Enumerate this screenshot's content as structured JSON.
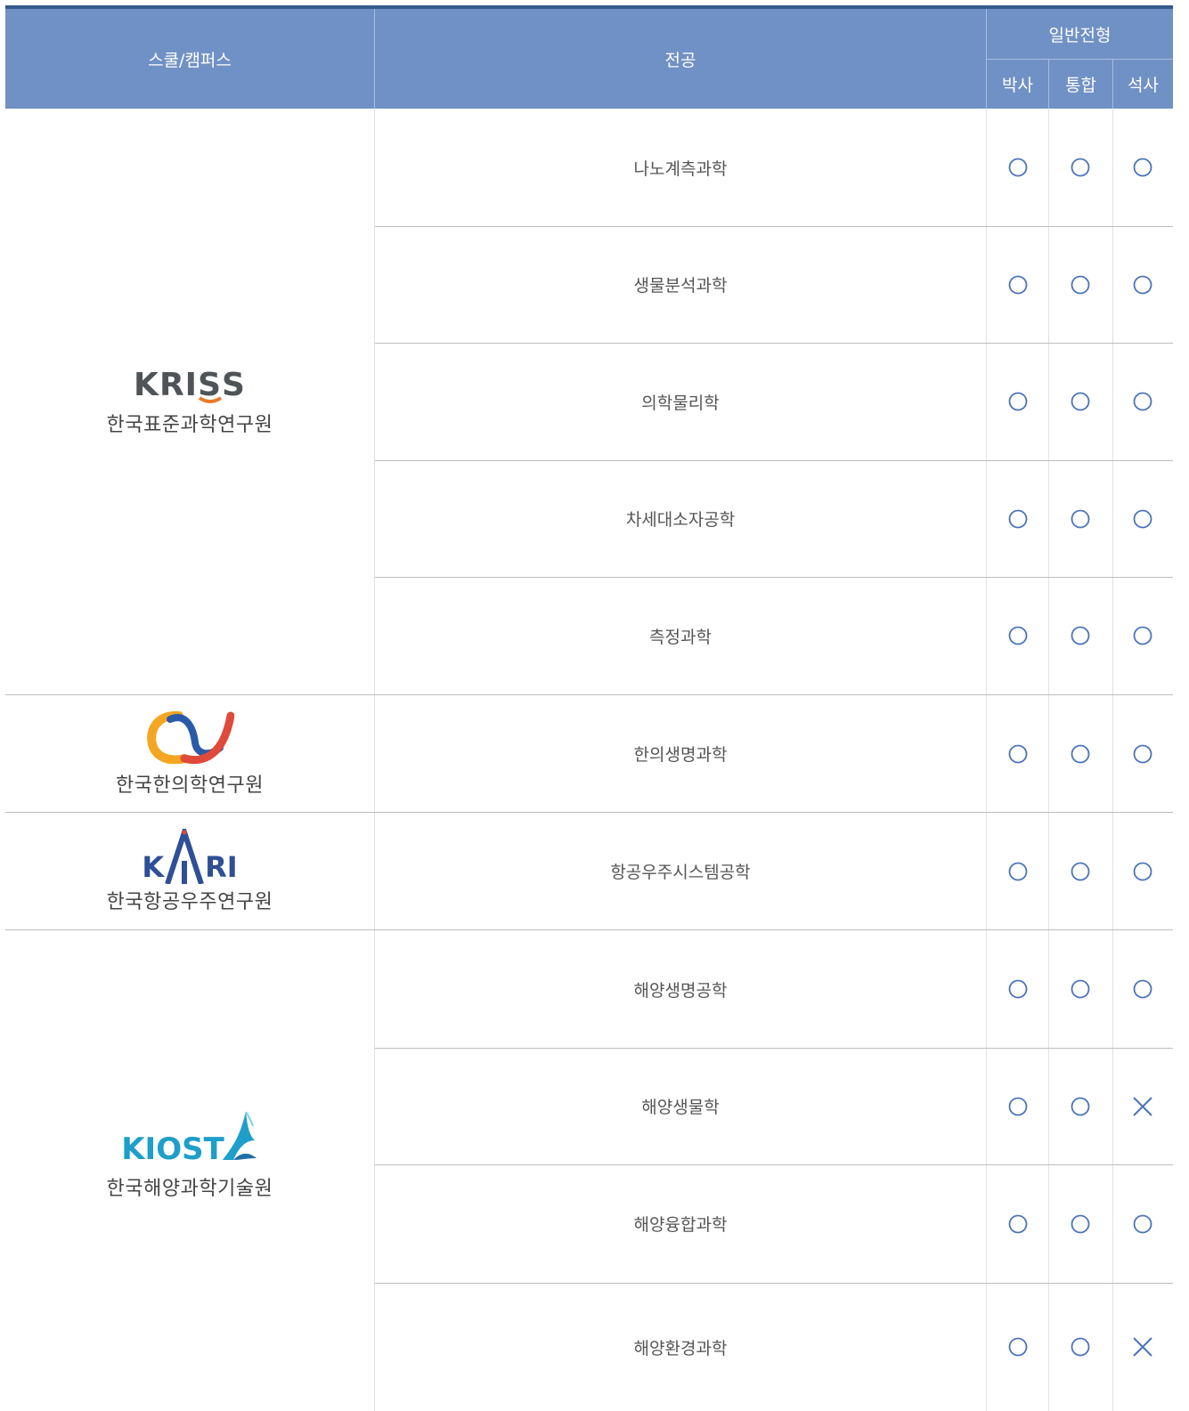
{
  "header": {
    "campus_label": "스쿨/캠퍼스",
    "major_label": "전공",
    "admission_group": "일반전형",
    "columns": [
      "박사",
      "통합",
      "석사"
    ]
  },
  "campuses": [
    {
      "key": "kriss",
      "logo_text": "KRISS",
      "name": "한국표준과학연구원"
    },
    {
      "key": "kiom",
      "logo_text": "",
      "name": "한국한의학연구원"
    },
    {
      "key": "kari",
      "logo_text": "KARI",
      "name": "한국항공우주연구원"
    },
    {
      "key": "kiost",
      "logo_text": "KIOST",
      "name": "한국해양과학기술원"
    }
  ],
  "rows": [
    {
      "major": "나노계측과학",
      "marks": [
        "O",
        "O",
        "O"
      ]
    },
    {
      "major": "생물분석과학",
      "marks": [
        "O",
        "O",
        "O"
      ]
    },
    {
      "major": "의학물리학",
      "marks": [
        "O",
        "O",
        "O"
      ]
    },
    {
      "major": "차세대소자공학",
      "marks": [
        "O",
        "O",
        "O"
      ]
    },
    {
      "major": "측정과학",
      "marks": [
        "O",
        "O",
        "O"
      ]
    },
    {
      "major": "한의생명과학",
      "marks": [
        "O",
        "O",
        "O"
      ]
    },
    {
      "major": "항공우주시스템공학",
      "marks": [
        "O",
        "O",
        "O"
      ]
    },
    {
      "major": "해양생명공학",
      "marks": [
        "O",
        "O",
        "O"
      ]
    },
    {
      "major": "해양생물학",
      "marks": [
        "O",
        "O",
        "X"
      ]
    },
    {
      "major": "해양융합과학",
      "marks": [
        "O",
        "O",
        "O"
      ]
    },
    {
      "major": "해양환경과학",
      "marks": [
        "O",
        "O",
        "X"
      ]
    }
  ],
  "colors": {
    "header_bg": "#7091c5",
    "top_rule": "#35598c",
    "mark_color": "#4a74b8"
  }
}
